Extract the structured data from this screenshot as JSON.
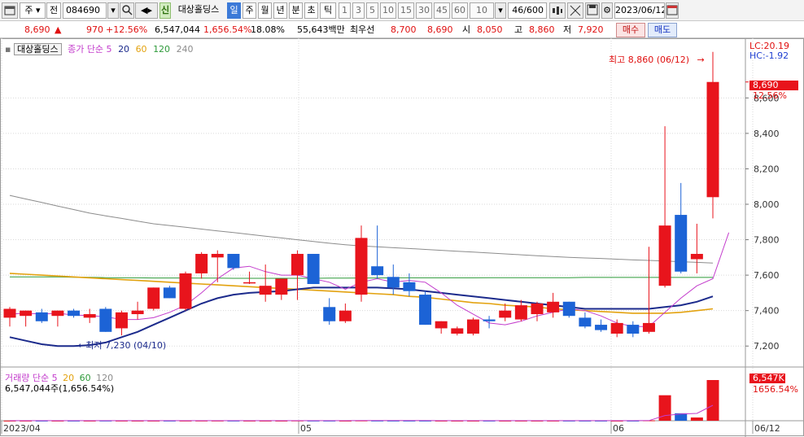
{
  "toolbar": {
    "market": "주",
    "prefix": "전",
    "code": "084690",
    "badge": "신",
    "name": "대상홀딩스",
    "periods": [
      "일",
      "주",
      "월",
      "년",
      "분",
      "초",
      "틱"
    ],
    "intervals": [
      "1",
      "3",
      "5",
      "10",
      "15",
      "30",
      "45",
      "60"
    ],
    "count": "10",
    "page": "46/600",
    "date": "2023/06/12"
  },
  "quote": {
    "price": "8,690",
    "arrow": "▲",
    "change": "970",
    "change_pct": "+12.56%",
    "volume": "6,547,044",
    "volume_ratio": "1,656.54%",
    "turnover": "18.08%",
    "amount": "55,643백만",
    "pref_label": "최우선",
    "ask": "8,700",
    "bid": "8,690",
    "open_label": "시",
    "open": "8,050",
    "high_label": "고",
    "high": "8,860",
    "low_label": "저",
    "low": "7,920",
    "buy_label": "매수",
    "sell_label": "매도"
  },
  "legend": {
    "name": "대상홀딩스",
    "ma_label": "종가 단순 5",
    "ma_periods": [
      "20",
      "60",
      "120",
      "240"
    ],
    "volume_label": "거래량 단순 5",
    "vol_periods": [
      "20",
      "60",
      "120"
    ],
    "volume_value": "6,547,044주(1,656.54%)"
  },
  "annotations": {
    "high_text": "최고 8,860 (06/12)",
    "low_text": "최저 7,230 (04/10)",
    "lc": "LC:20.19",
    "hc": "HC:-1.92",
    "current_price": "8,690",
    "current_pct": "12.56%",
    "current_volume": "6,547K",
    "current_vol_pct": "1656.54%"
  },
  "colors": {
    "up": "#e8141c",
    "down": "#1c63d6",
    "ma5": "#c33ccc",
    "ma20": "#1c2b8c",
    "ma60": "#e3a20f",
    "ma120": "#2e9a3a",
    "ma240": "#8c8c8c"
  },
  "chart_data": {
    "type": "candlestick",
    "y_ticks": [
      7200,
      7400,
      7600,
      7800,
      8000,
      8200,
      8400,
      8600
    ],
    "y_tick_labels": [
      "7,200",
      "7,400",
      "7,600",
      "7,800",
      "8,000",
      "8,200",
      "8,400",
      "8,600"
    ],
    "ylim": [
      7100,
      8900
    ],
    "x_labels": [
      "2023/04",
      "05",
      "06",
      "06/12"
    ],
    "candles": [
      {
        "o": 7360,
        "h": 7420,
        "l": 7310,
        "c": 7410
      },
      {
        "o": 7370,
        "h": 7400,
        "l": 7310,
        "c": 7400
      },
      {
        "o": 7390,
        "h": 7410,
        "l": 7330,
        "c": 7340
      },
      {
        "o": 7370,
        "h": 7400,
        "l": 7310,
        "c": 7400
      },
      {
        "o": 7400,
        "h": 7410,
        "l": 7360,
        "c": 7370
      },
      {
        "o": 7360,
        "h": 7410,
        "l": 7330,
        "c": 7380
      },
      {
        "o": 7410,
        "h": 7420,
        "l": 7280,
        "c": 7280
      },
      {
        "o": 7300,
        "h": 7400,
        "l": 7260,
        "c": 7390
      },
      {
        "o": 7380,
        "h": 7450,
        "l": 7350,
        "c": 7400
      },
      {
        "o": 7410,
        "h": 7530,
        "l": 7400,
        "c": 7530
      },
      {
        "o": 7530,
        "h": 7540,
        "l": 7470,
        "c": 7470
      },
      {
        "o": 7410,
        "h": 7620,
        "l": 7400,
        "c": 7610
      },
      {
        "o": 7610,
        "h": 7730,
        "l": 7580,
        "c": 7720
      },
      {
        "o": 7700,
        "h": 7740,
        "l": 7560,
        "c": 7720
      },
      {
        "o": 7720,
        "h": 7720,
        "l": 7630,
        "c": 7640
      },
      {
        "o": 7560,
        "h": 7620,
        "l": 7550,
        "c": 7560
      },
      {
        "o": 7490,
        "h": 7660,
        "l": 7450,
        "c": 7540
      },
      {
        "o": 7490,
        "h": 7570,
        "l": 7460,
        "c": 7580
      },
      {
        "o": 7600,
        "h": 7740,
        "l": 7460,
        "c": 7720
      },
      {
        "o": 7720,
        "h": 7720,
        "l": 7550,
        "c": 7550
      },
      {
        "o": 7420,
        "h": 7470,
        "l": 7320,
        "c": 7340
      },
      {
        "o": 7340,
        "h": 7440,
        "l": 7330,
        "c": 7400
      },
      {
        "o": 7490,
        "h": 7880,
        "l": 7450,
        "c": 7810
      },
      {
        "o": 7650,
        "h": 7880,
        "l": 7580,
        "c": 7600
      },
      {
        "o": 7590,
        "h": 7660,
        "l": 7490,
        "c": 7530
      },
      {
        "o": 7560,
        "h": 7610,
        "l": 7480,
        "c": 7510
      },
      {
        "o": 7490,
        "h": 7510,
        "l": 7320,
        "c": 7320
      },
      {
        "o": 7300,
        "h": 7340,
        "l": 7270,
        "c": 7340
      },
      {
        "o": 7270,
        "h": 7310,
        "l": 7260,
        "c": 7300
      },
      {
        "o": 7270,
        "h": 7360,
        "l": 7260,
        "c": 7350
      },
      {
        "o": 7350,
        "h": 7370,
        "l": 7300,
        "c": 7340
      },
      {
        "o": 7360,
        "h": 7440,
        "l": 7340,
        "c": 7400
      },
      {
        "o": 7350,
        "h": 7460,
        "l": 7340,
        "c": 7430
      },
      {
        "o": 7380,
        "h": 7450,
        "l": 7340,
        "c": 7440
      },
      {
        "o": 7390,
        "h": 7500,
        "l": 7360,
        "c": 7450
      },
      {
        "o": 7450,
        "h": 7450,
        "l": 7360,
        "c": 7370
      },
      {
        "o": 7360,
        "h": 7390,
        "l": 7300,
        "c": 7310
      },
      {
        "o": 7320,
        "h": 7350,
        "l": 7280,
        "c": 7290
      },
      {
        "o": 7270,
        "h": 7350,
        "l": 7250,
        "c": 7330
      },
      {
        "o": 7320,
        "h": 7340,
        "l": 7250,
        "c": 7270
      },
      {
        "o": 7280,
        "h": 7760,
        "l": 7270,
        "c": 7330
      },
      {
        "o": 7540,
        "h": 8440,
        "l": 7530,
        "c": 7880
      },
      {
        "o": 7940,
        "h": 8120,
        "l": 7610,
        "c": 7620
      },
      {
        "o": 7690,
        "h": 7890,
        "l": 7610,
        "c": 7720
      },
      {
        "o": 8040,
        "h": 8860,
        "l": 7920,
        "c": 8690
      }
    ],
    "ma5": [
      7380,
      7385,
      7380,
      7385,
      7375,
      7372,
      7365,
      7350,
      7350,
      7360,
      7390,
      7430,
      7500,
      7580,
      7640,
      7650,
      7620,
      7600,
      7600,
      7580,
      7560,
      7520,
      7560,
      7580,
      7560,
      7570,
      7560,
      7500,
      7430,
      7380,
      7330,
      7320,
      7340,
      7370,
      7390,
      7410,
      7400,
      7370,
      7330,
      7310,
      7310,
      7390,
      7470,
      7540,
      7580,
      7840
    ],
    "ma20": [
      7250,
      7230,
      7210,
      7200,
      7200,
      7205,
      7220,
      7250,
      7280,
      7320,
      7360,
      7400,
      7440,
      7470,
      7490,
      7500,
      7505,
      7510,
      7520,
      7530,
      7530,
      7530,
      7530,
      7530,
      7525,
      7520,
      7510,
      7500,
      7490,
      7480,
      7470,
      7460,
      7450,
      7440,
      7430,
      7420,
      7410,
      7410,
      7410,
      7410,
      7410,
      7420,
      7430,
      7450,
      7480
    ],
    "ma60": [
      7610,
      7605,
      7600,
      7595,
      7590,
      7585,
      7580,
      7575,
      7570,
      7565,
      7560,
      7555,
      7550,
      7545,
      7540,
      7535,
      7530,
      7525,
      7520,
      7515,
      7510,
      7505,
      7500,
      7495,
      7490,
      7480,
      7475,
      7465,
      7455,
      7445,
      7440,
      7430,
      7425,
      7420,
      7410,
      7405,
      7400,
      7395,
      7390,
      7385,
      7385,
      7385,
      7390,
      7400,
      7410
    ],
    "ma120": [
      7590,
      7590,
      7590,
      7590,
      7588,
      7588,
      7586,
      7585,
      7585,
      7584,
      7584,
      7584,
      7583,
      7583,
      7582,
      7582,
      7582,
      7582,
      7582,
      7582,
      7583,
      7583,
      7584,
      7584,
      7585,
      7585,
      7585,
      7585,
      7585,
      7585,
      7586,
      7586,
      7586,
      7586,
      7586,
      7586,
      7587,
      7587,
      7587,
      7587,
      7587,
      7587,
      7587,
      7587,
      7587
    ],
    "ma240": [
      8050,
      8030,
      8010,
      7990,
      7970,
      7950,
      7935,
      7920,
      7905,
      7890,
      7880,
      7870,
      7860,
      7850,
      7840,
      7830,
      7820,
      7810,
      7800,
      7790,
      7780,
      7772,
      7765,
      7760,
      7755,
      7750,
      7745,
      7740,
      7735,
      7730,
      7725,
      7720,
      7715,
      7710,
      7705,
      7700,
      7697,
      7694,
      7690,
      7686,
      7683,
      7680,
      7676,
      7672,
      7668
    ],
    "volume_ylim": [
      0,
      6547044
    ],
    "volume": [
      15000,
      14000,
      12000,
      13000,
      11000,
      12000,
      18000,
      14000,
      12000,
      13000,
      12000,
      16000,
      20000,
      22000,
      15000,
      13000,
      12000,
      11000,
      35000,
      18000,
      14000,
      12000,
      40000,
      22000,
      16000,
      15000,
      14000,
      12000,
      11000,
      10000,
      12000,
      11000,
      13000,
      12000,
      14000,
      13000,
      11000,
      10000,
      11000,
      12000,
      60000,
      4100000,
      1200000,
      520000,
      6547044
    ],
    "vol_ma5": [
      15000,
      14800,
      14500,
      14200,
      13000,
      12400,
      13600,
      13600,
      13400,
      13800,
      13800,
      13400,
      14600,
      16600,
      17000,
      17200,
      16400,
      14600,
      17000,
      18000,
      18000,
      18000,
      23800,
      25200,
      22000,
      21000,
      20200,
      15800,
      13600,
      12400,
      11800,
      11400,
      11600,
      11600,
      12400,
      12600,
      12200,
      12000,
      11600,
      11800,
      21200,
      838400,
      1078600,
      1178400,
      2485400
    ]
  }
}
